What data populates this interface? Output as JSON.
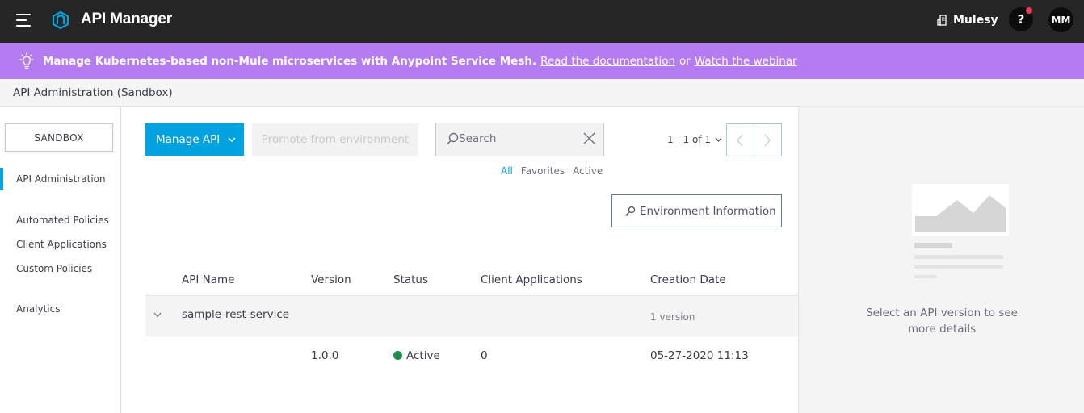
{
  "header": {
    "app_title": "API Manager",
    "org_name": "Mulesy",
    "help_label": "?",
    "user_initials": "MM"
  },
  "banner": {
    "message": "Manage Kubernetes-based non-Mule microservices with Anypoint Service Mesh.",
    "link_docs": "Read the documentation",
    "separator": "or",
    "link_webinar": "Watch the webinar"
  },
  "breadcrumb": {
    "title": "API Administration (Sandbox)"
  },
  "sidebar": {
    "environment": "SANDBOX",
    "items": [
      {
        "label": "API Administration",
        "active": true
      },
      {
        "label": "Automated Policies",
        "active": false
      },
      {
        "label": "Client Applications",
        "active": false
      },
      {
        "label": "Custom Policies",
        "active": false
      },
      {
        "label": "Analytics",
        "active": false
      }
    ]
  },
  "toolbar": {
    "manage_api_label": "Manage API",
    "promote_label": "Promote from environment",
    "search_placeholder": "Search",
    "pagination": "1 - 1 of 1",
    "env_info_label": "Environment Information"
  },
  "filters": {
    "all": "All",
    "favorites": "Favorites",
    "active": "Active",
    "selected": "All"
  },
  "table": {
    "columns": [
      "API Name",
      "Version",
      "Status",
      "Client Applications",
      "Creation Date"
    ],
    "groups": [
      {
        "name": "sample-rest-service",
        "version_count": "1 version",
        "rows": [
          {
            "version": "1.0.0",
            "status": "Active",
            "client_apps": "0",
            "creation_date": "05-27-2020 11:13"
          }
        ]
      }
    ]
  },
  "detail": {
    "empty_message": "Select an API version to see more details"
  },
  "colors": {
    "topbar": "#262626",
    "banner": "#b57cf2",
    "accent": "#00a2df",
    "status_active": "#1e8c4a",
    "notification": "#e73d55"
  },
  "icons": {
    "menu": "hamburger-icon",
    "logo": "api-manager-logo-icon",
    "org": "building-icon",
    "banner": "lightbulb-icon",
    "search": "search-icon",
    "clear": "close-icon",
    "env_info": "key-icon"
  }
}
